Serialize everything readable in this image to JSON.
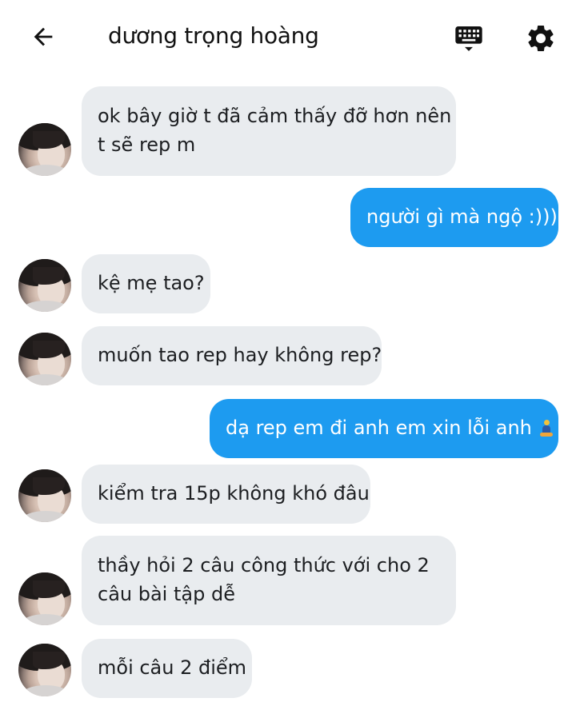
{
  "header": {
    "title": "dương trọng hoàng",
    "back_icon": "arrow-left-icon",
    "keyboard_icon": "keyboard-icon",
    "settings_icon": "gear-icon"
  },
  "messages": [
    {
      "dir": "in",
      "lines": [
        "ok bây giờ t đã cảm thấy đỡ hơn nên",
        "t sẽ rep m"
      ]
    },
    {
      "dir": "out",
      "lines": [
        "người gì mà ngộ :)))"
      ]
    },
    {
      "dir": "in",
      "lines": [
        "kệ mẹ tao?"
      ]
    },
    {
      "dir": "in",
      "lines": [
        "muốn tao rep hay không rep?"
      ]
    },
    {
      "dir": "out",
      "lines": [
        "dạ rep em đi anh em xin lỗi anh"
      ],
      "emoji": "person-praying-emoji"
    },
    {
      "dir": "in",
      "lines": [
        "kiểm tra 15p không khó đâu"
      ]
    },
    {
      "dir": "in",
      "lines": [
        "thầy hỏi 2 câu công thức với cho 2",
        "câu bài tập dễ"
      ]
    },
    {
      "dir": "in",
      "lines": [
        "mỗi câu 2 điểm"
      ]
    }
  ],
  "colors": {
    "incoming_bubble": "#e9ecef",
    "outgoing_bubble": "#1d9bf0",
    "outgoing_text": "#ffffff"
  }
}
